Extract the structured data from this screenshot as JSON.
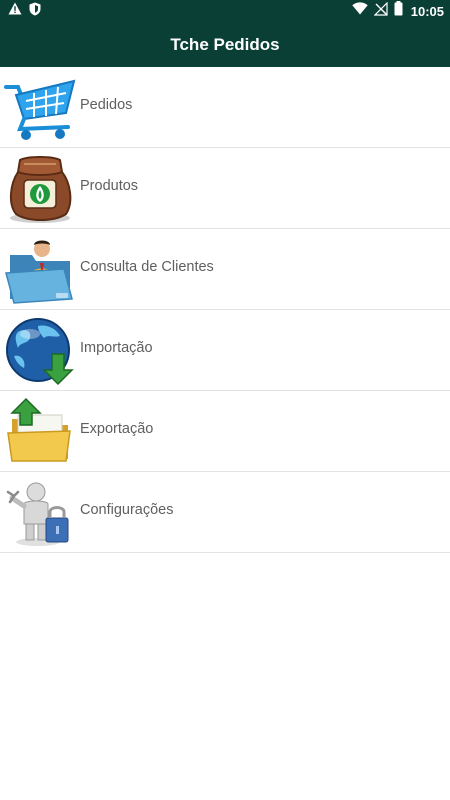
{
  "statusbar": {
    "time": "10:05",
    "left_icons": [
      "warning-icon",
      "shield-icon"
    ],
    "right_icons": [
      "wifi-icon",
      "no-signal-icon",
      "battery-icon"
    ]
  },
  "appbar": {
    "title": "Tche Pedidos",
    "background": "#0a3f36"
  },
  "menu": {
    "items": [
      {
        "label": "Pedidos",
        "icon": "shopping-cart-icon"
      },
      {
        "label": "Produtos",
        "icon": "seed-sack-icon"
      },
      {
        "label": "Consulta de Clientes",
        "icon": "client-folder-icon"
      },
      {
        "label": "Importação",
        "icon": "globe-download-icon"
      },
      {
        "label": "Exportação",
        "icon": "folder-upload-icon"
      },
      {
        "label": "Configurações",
        "icon": "settings-person-icon"
      }
    ]
  }
}
